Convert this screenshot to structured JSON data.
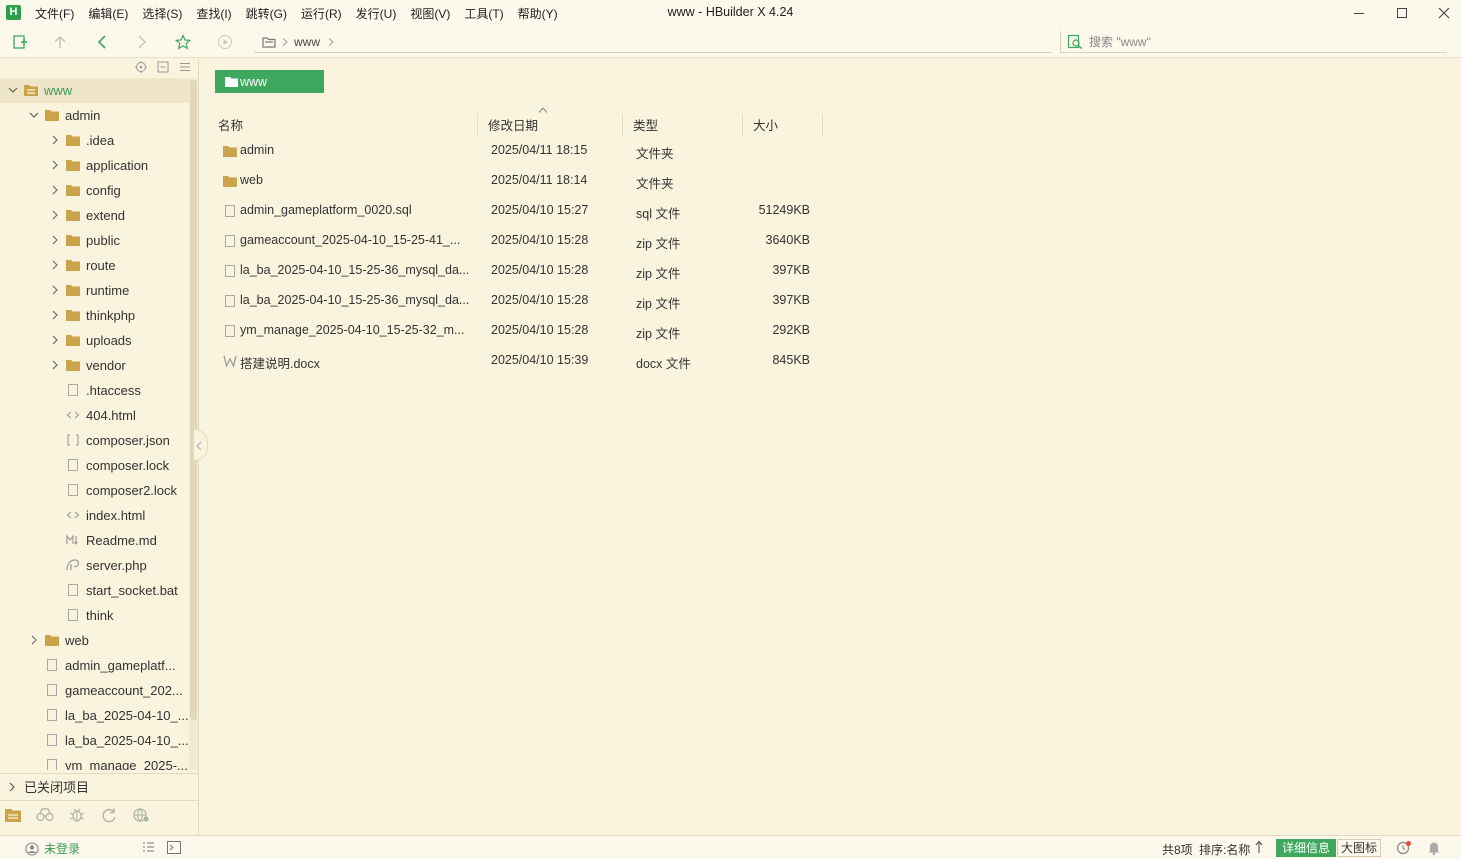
{
  "app": {
    "logo_letter": "H",
    "window_title": "www - HBuilder X 4.24",
    "menu": [
      "文件(F)",
      "编辑(E)",
      "选择(S)",
      "查找(I)",
      "跳转(G)",
      "运行(R)",
      "发行(U)",
      "视图(V)",
      "工具(T)",
      "帮助(Y)"
    ]
  },
  "toolbar": {
    "breadcrumb": [
      "www"
    ],
    "search_placeholder": "搜索 \"www\""
  },
  "sidebar": {
    "tree": [
      {
        "label": "www",
        "kind": "folder",
        "expanded": true,
        "depth": 0,
        "root": true,
        "selected": true
      },
      {
        "label": "admin",
        "kind": "folder",
        "expanded": true,
        "depth": 1
      },
      {
        "label": ".idea",
        "kind": "folder",
        "expanded": false,
        "depth": 2
      },
      {
        "label": "application",
        "kind": "folder",
        "expanded": false,
        "depth": 2
      },
      {
        "label": "config",
        "kind": "folder",
        "expanded": false,
        "depth": 2
      },
      {
        "label": "extend",
        "kind": "folder",
        "expanded": false,
        "depth": 2
      },
      {
        "label": "public",
        "kind": "folder",
        "expanded": false,
        "depth": 2
      },
      {
        "label": "route",
        "kind": "folder",
        "expanded": false,
        "depth": 2
      },
      {
        "label": "runtime",
        "kind": "folder",
        "expanded": false,
        "depth": 2
      },
      {
        "label": "thinkphp",
        "kind": "folder",
        "expanded": false,
        "depth": 2
      },
      {
        "label": "uploads",
        "kind": "folder",
        "expanded": false,
        "depth": 2
      },
      {
        "label": "vendor",
        "kind": "folder",
        "expanded": false,
        "depth": 2
      },
      {
        "label": ".htaccess",
        "kind": "file",
        "depth": 2
      },
      {
        "label": "404.html",
        "kind": "html",
        "depth": 2
      },
      {
        "label": "composer.json",
        "kind": "json",
        "depth": 2
      },
      {
        "label": "composer.lock",
        "kind": "file",
        "depth": 2
      },
      {
        "label": "composer2.lock",
        "kind": "file",
        "depth": 2
      },
      {
        "label": "index.html",
        "kind": "html",
        "depth": 2
      },
      {
        "label": "Readme.md",
        "kind": "md",
        "depth": 2
      },
      {
        "label": "server.php",
        "kind": "php",
        "depth": 2
      },
      {
        "label": "start_socket.bat",
        "kind": "file",
        "depth": 2
      },
      {
        "label": "think",
        "kind": "file",
        "depth": 2
      },
      {
        "label": "web",
        "kind": "folder",
        "expanded": false,
        "depth": 1
      },
      {
        "label": "admin_gameplatf...",
        "kind": "file",
        "depth": 1
      },
      {
        "label": "gameaccount_202...",
        "kind": "file",
        "depth": 1
      },
      {
        "label": "la_ba_2025-04-10_...",
        "kind": "file",
        "depth": 1
      },
      {
        "label": "la_ba_2025-04-10_...",
        "kind": "file",
        "depth": 1
      },
      {
        "label": "ym_manage_2025-...",
        "kind": "file",
        "depth": 1
      }
    ],
    "closed_projects_label": "已关闭项目"
  },
  "main": {
    "path_chip": "www",
    "columns": {
      "name": "名称",
      "date": "修改日期",
      "type": "类型",
      "size": "大小"
    },
    "files": [
      {
        "name": "admin",
        "date": "2025/04/11 18:15",
        "type": "文件夹",
        "size": "",
        "kind": "folder"
      },
      {
        "name": "web",
        "date": "2025/04/11 18:14",
        "type": "文件夹",
        "size": "",
        "kind": "folder"
      },
      {
        "name": "admin_gameplatform_0020.sql",
        "date": "2025/04/10 15:27",
        "type": "sql 文件",
        "size": "51249KB",
        "kind": "file"
      },
      {
        "name": "gameaccount_2025-04-10_15-25-41_...",
        "date": "2025/04/10 15:28",
        "type": "zip 文件",
        "size": "3640KB",
        "kind": "file"
      },
      {
        "name": "la_ba_2025-04-10_15-25-36_mysql_da...",
        "date": "2025/04/10 15:28",
        "type": "zip 文件",
        "size": "397KB",
        "kind": "file"
      },
      {
        "name": "la_ba_2025-04-10_15-25-36_mysql_da...",
        "date": "2025/04/10 15:28",
        "type": "zip 文件",
        "size": "397KB",
        "kind": "file"
      },
      {
        "name": "ym_manage_2025-04-10_15-25-32_m...",
        "date": "2025/04/10 15:28",
        "type": "zip 文件",
        "size": "292KB",
        "kind": "file"
      },
      {
        "name": "搭建说明.docx",
        "date": "2025/04/10 15:39",
        "type": "docx 文件",
        "size": "845KB",
        "kind": "word"
      }
    ]
  },
  "status": {
    "login": "未登录",
    "count": "共8项",
    "sort": "排序:名称",
    "view_detail": "详细信息",
    "view_large": "大图标"
  },
  "colors": {
    "accent": "#3EA85F",
    "background": "#FAF3DE",
    "folder": "#C9A44A"
  }
}
